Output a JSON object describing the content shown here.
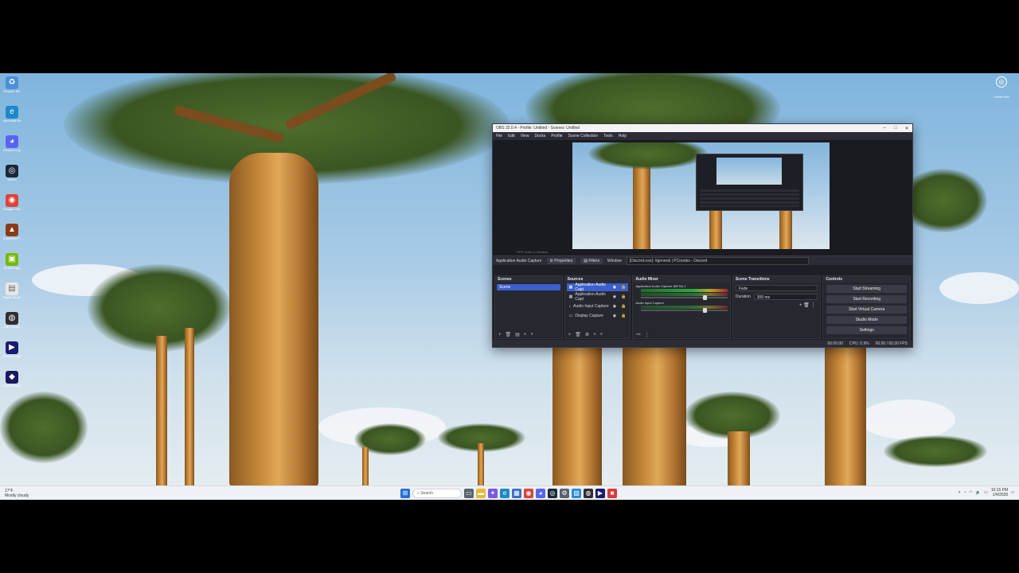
{
  "desktop": {
    "icons": [
      {
        "label": "Recycle Bin",
        "icon": "recycle-bin-icon",
        "glyph": "♻",
        "color": "#4a8fd8"
      },
      {
        "label": "Microsoft Edge",
        "icon": "edge-icon",
        "glyph": "e",
        "color": "#1e88c8"
      },
      {
        "label": "Discord Copy",
        "icon": "discord-icon",
        "glyph": "◕",
        "color": "#5865f2"
      },
      {
        "label": "Steam",
        "icon": "steam-icon",
        "glyph": "◎",
        "color": "#1b2838"
      },
      {
        "label": "Google Chrome",
        "icon": "chrome-icon",
        "glyph": "◉",
        "color": "#db4437"
      },
      {
        "label": "Battlefield™ 6",
        "icon": "game-icon",
        "glyph": "▲",
        "color": "#8c3a1a"
      },
      {
        "label": "NVIDIA App",
        "icon": "nvidia-icon",
        "glyph": "▣",
        "color": "#76b900"
      },
      {
        "label": "Rapid Studio",
        "icon": "file-icon",
        "glyph": "▤",
        "color": "#e8e8e8"
      },
      {
        "label": "OBS Studio",
        "icon": "obs-icon",
        "glyph": "◍",
        "color": "#302e31"
      },
      {
        "label": "Screen Capture HD",
        "icon": "capture-icon",
        "glyph": "▶",
        "color": "#1a1a6e"
      },
      {
        "label": "Screen Capture",
        "icon": "record-icon",
        "glyph": "◆",
        "color": "#1a1a5e"
      }
    ],
    "right_icon": {
      "label": "Game Hub",
      "icon": "settings-circle-icon",
      "glyph": "◎"
    }
  },
  "taskbar": {
    "weather": "17°F",
    "weather_sub": "Mostly cloudy",
    "search_placeholder": "Search",
    "apps": [
      {
        "icon": "start-icon",
        "glyph": "⊞",
        "color": "#1f6fd6"
      },
      {
        "icon": "taskview-icon",
        "glyph": "▭",
        "color": "#5a6470"
      },
      {
        "icon": "explorer-icon",
        "glyph": "▬",
        "color": "#e8b838"
      },
      {
        "icon": "copilot-icon",
        "glyph": "✦",
        "color": "#7a5ae0"
      },
      {
        "icon": "edge-icon",
        "glyph": "e",
        "color": "#1e88c8"
      },
      {
        "icon": "store-icon",
        "glyph": "▦",
        "color": "#3a6fd0"
      },
      {
        "icon": "chrome-icon",
        "glyph": "◉",
        "color": "#db4437"
      },
      {
        "icon": "discord-icon",
        "glyph": "◕",
        "color": "#5865f2"
      },
      {
        "icon": "steam-icon",
        "glyph": "◎",
        "color": "#1b2838"
      },
      {
        "icon": "settings-icon",
        "glyph": "⚙",
        "color": "#5a6470"
      },
      {
        "icon": "photos-icon",
        "glyph": "▨",
        "color": "#2c8ad8"
      },
      {
        "icon": "obs-icon",
        "glyph": "◍",
        "color": "#302e31"
      },
      {
        "icon": "capture-icon",
        "glyph": "▶",
        "color": "#1a1a6e"
      },
      {
        "icon": "recorder-icon",
        "glyph": "■",
        "color": "#d83b3b"
      }
    ],
    "time": "10:15 PM",
    "date": "1/4/2026"
  },
  "obs": {
    "title": "OBS 32.0.4 - Profile: Untitled - Scenes: Untitled",
    "menu": [
      "File",
      "Edit",
      "View",
      "Docks",
      "Profile",
      "Scene Collection",
      "Tools",
      "Help"
    ],
    "preview_status": "DPS    Scale to Window",
    "context": {
      "source": "Application Audio Capture",
      "properties": "Properties",
      "filters": "Filters",
      "window_label": "Window",
      "window_value": "[Discord.exe]: #general | PCnoobs - Discord"
    },
    "scenes": {
      "title": "Scenes",
      "items": [
        "Scene"
      ]
    },
    "sources": {
      "title": "Sources",
      "items": [
        {
          "name": "Application Audio Capt",
          "icon": "app-audio-icon",
          "glyph": "▦"
        },
        {
          "name": "Application Audio Capt",
          "icon": "app-audio-icon",
          "glyph": "▦"
        },
        {
          "name": "Audio Input Capture",
          "icon": "microphone-icon",
          "glyph": "♪"
        },
        {
          "name": "Display Capture",
          "icon": "monitor-icon",
          "glyph": "▭"
        }
      ]
    },
    "mixer": {
      "title": "Audio Mixer",
      "channels": [
        "Application Audio Capture (BETA) 2",
        "Audio Input Capture"
      ]
    },
    "transitions": {
      "title": "Scene Transitions",
      "type": "Fade",
      "duration_label": "Duration",
      "duration_value": "300 ms"
    },
    "controls": {
      "title": "Controls",
      "buttons": [
        "Start Streaming",
        "Start Recording",
        "Start Virtual Camera",
        "Studio Mode",
        "Settings"
      ]
    },
    "status": {
      "time": "00:00:00",
      "cpu": "CPU: 0.9%",
      "fps": "60.00 / 60.00 FPS"
    }
  }
}
